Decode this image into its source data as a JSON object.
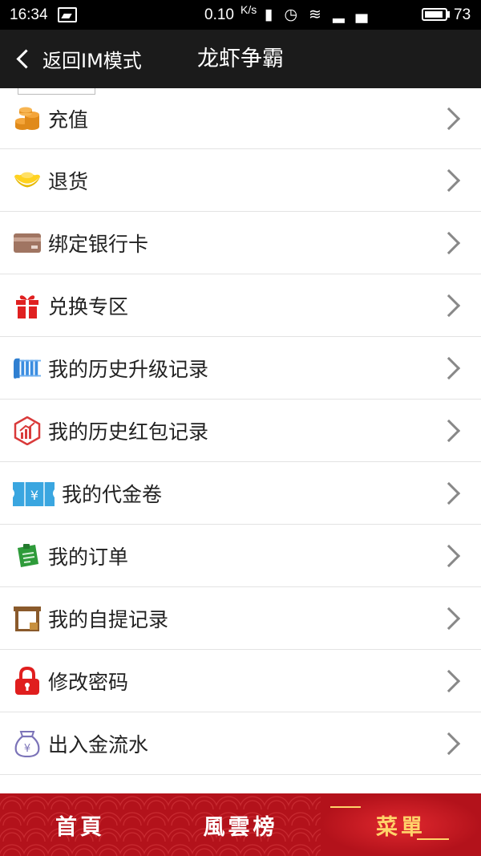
{
  "status_bar": {
    "time": "16:34",
    "speed": "0.10",
    "speed_unit": "K/s",
    "battery": "73"
  },
  "nav": {
    "back_label": "返回IM模式",
    "title": "龙虾争霸"
  },
  "menu_items": [
    {
      "label": "充值",
      "icon": "coins-icon"
    },
    {
      "label": "退货",
      "icon": "gold-ingot-icon"
    },
    {
      "label": "绑定银行卡",
      "icon": "bank-card-icon"
    },
    {
      "label": "兑换专区",
      "icon": "gift-icon"
    },
    {
      "label": "我的历史升级记录",
      "icon": "upgrade-history-icon"
    },
    {
      "label": "我的历史红包记录",
      "icon": "chart-hexagon-icon"
    },
    {
      "label": "我的代金卷",
      "icon": "voucher-icon"
    },
    {
      "label": "我的订单",
      "icon": "order-icon"
    },
    {
      "label": "我的自提记录",
      "icon": "store-icon"
    },
    {
      "label": "修改密码",
      "icon": "lock-icon"
    },
    {
      "label": "出入金流水",
      "icon": "money-bag-icon"
    }
  ],
  "bottom_tabs": [
    {
      "label": "首頁"
    },
    {
      "label": "風雲榜"
    },
    {
      "label": "菜單"
    }
  ],
  "colors": {
    "nav_bg": "#1b1b1b",
    "bottom_bar_bg": "#b3121b",
    "menu_tab_text": "#ffd36a"
  }
}
